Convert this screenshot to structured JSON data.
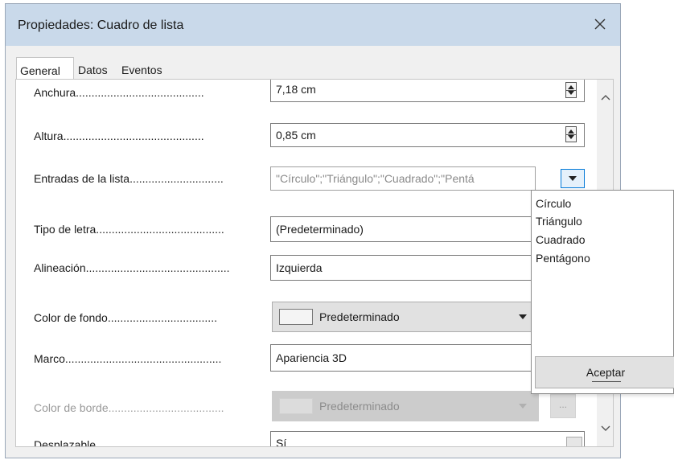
{
  "window": {
    "title": "Propiedades: Cuadro de lista",
    "close_glyph": "✕"
  },
  "tabs": [
    {
      "label": "General",
      "active": true
    },
    {
      "label": "Datos",
      "active": false
    },
    {
      "label": "Eventos",
      "active": false
    }
  ],
  "properties": {
    "anchura": {
      "label": "Anchura.........................................",
      "value": "7,18 cm"
    },
    "altura": {
      "label": "Altura.............................................",
      "value": "0,85 cm"
    },
    "entradas": {
      "label": "Entradas de la lista..............................",
      "value": "\"Círculo\";\"Triángulo\";\"Cuadrado\";\"Pentá"
    },
    "tipo_letra": {
      "label": "Tipo de letra.........................................",
      "value": "(Predeterminado)"
    },
    "alineacion": {
      "label": "Alineación..............................................",
      "value": "Izquierda"
    },
    "color_fondo": {
      "label": "Color de fondo...................................",
      "value": "Predeterminado"
    },
    "marco": {
      "label": "Marco..................................................",
      "value": "Apariencia 3D"
    },
    "color_borde": {
      "label": "Color de borde.....................................",
      "value": "Predeterminado",
      "ellipsis": "..."
    },
    "partial_row": {
      "label": "Desplazable",
      "value": "Sí"
    }
  },
  "popup": {
    "items": [
      "Círculo",
      "Triángulo",
      "Cuadrado",
      "Pentágono"
    ],
    "accept_label": "Aceptar"
  },
  "colors": {
    "titlebar": "#c9d9ea",
    "tab_accent": "#d21a1a",
    "dropdown_focus": "#0078d7"
  }
}
